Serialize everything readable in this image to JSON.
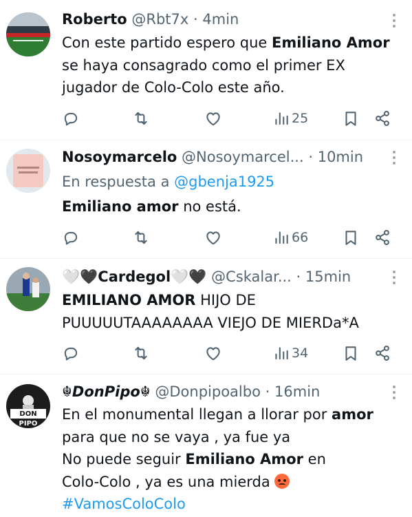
{
  "tweets": [
    {
      "name": "Roberto",
      "handle": "@Rbt7x",
      "dot": "·",
      "time": "4min",
      "body": [
        {
          "t": "Con este partido espero que "
        },
        {
          "t": "Emiliano Amor",
          "b": true
        },
        {
          "t": " se haya consagrado como el primer EX jugador de Colo-Colo este año."
        }
      ],
      "views": "25"
    },
    {
      "name": "Nosoymarcelo",
      "handle": "@Nosoymarcel...",
      "dot": "·",
      "time": "10min",
      "reply_prefix": "En respuesta a ",
      "reply_mention": "@gbenja1925",
      "body": [
        {
          "t": "Emiliano amor",
          "b": true
        },
        {
          "t": " no está."
        }
      ],
      "views": "66"
    },
    {
      "name": "🤍🖤Cardegol🤍🖤",
      "handle": "@Cskalar...",
      "dot": "·",
      "time": "15min",
      "body": [
        {
          "t": "EMILIANO AMOR",
          "b": true
        },
        {
          "t": " HIJO DE PUUUUUTAAAAAAAA VIEJO DE MIERDa*A"
        }
      ],
      "views": "34"
    },
    {
      "name": "☬DonPipo☬",
      "handle": "@Donpipoalbo",
      "dot": "·",
      "time": "16min",
      "body_lines": [
        [
          {
            "t": "En el monumental llegan a llorar por "
          },
          {
            "t": "amor",
            "b": true
          }
        ],
        [
          {
            "t": "para que no se vaya , ya fue ya"
          }
        ],
        [
          {
            "t": "No puede seguir "
          },
          {
            "t": "Emiliano Amor",
            "b": true
          },
          {
            "t": " en"
          }
        ],
        [
          {
            "t": "Colo-Colo , ya es una mierda "
          },
          {
            "emoji": "angry-face"
          }
        ],
        [
          {
            "t": "#VamosColoColo",
            "tag": true
          }
        ]
      ],
      "avatar_text": [
        "DON",
        "PIPO"
      ]
    }
  ],
  "icons": [
    "reply-icon",
    "retweet-icon",
    "like-icon",
    "views-icon",
    "bookmark-icon",
    "share-icon",
    "more-icon"
  ],
  "colors": {
    "text": "#0f1419",
    "muted": "#536471",
    "link": "#1d9bf0",
    "divider": "#eff3f4"
  }
}
